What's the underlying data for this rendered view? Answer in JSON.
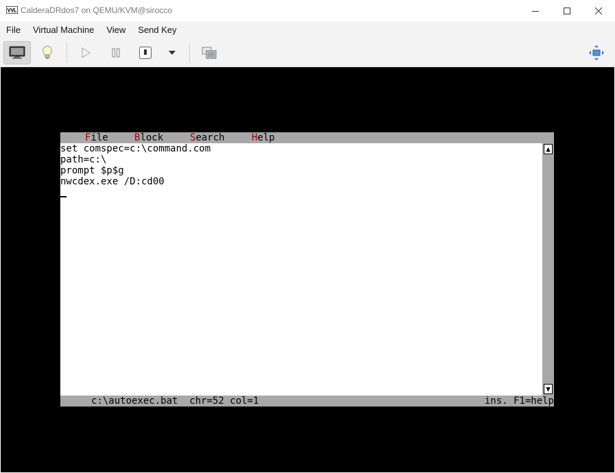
{
  "window": {
    "title": "CalderaDRdos7 on QEMU/KVM@sirocco",
    "icon": "virt-manager-icon",
    "controls": [
      "minimize-icon",
      "maximize-icon",
      "close-icon"
    ]
  },
  "menubar": {
    "items": [
      "File",
      "Virtual Machine",
      "View",
      "Send Key"
    ]
  },
  "toolbar": {
    "buttons": [
      {
        "name": "console-icon",
        "active": true
      },
      {
        "name": "details-bulb-icon",
        "active": false
      },
      {
        "name": "run-icon",
        "active": false
      },
      {
        "name": "pause-icon",
        "active": false
      },
      {
        "name": "power-icon",
        "active": false
      },
      {
        "name": "dropdown-arrow-icon",
        "active": false
      },
      {
        "name": "snapshots-icon",
        "active": false
      },
      {
        "name": "fullscreen-resize-icon",
        "active": false
      }
    ]
  },
  "dos_editor": {
    "menu": [
      {
        "hotkey": "F",
        "rest": "ile"
      },
      {
        "hotkey": "B",
        "rest": "lock"
      },
      {
        "hotkey": "S",
        "rest": "earch"
      },
      {
        "hotkey": "H",
        "rest": "elp"
      }
    ],
    "lines": [
      "set comspec=c:\\command.com",
      "path=c:\\",
      "prompt $p$g",
      "nwcdex.exe /D:cd00"
    ],
    "status_left": "c:\\autoexec.bat  chr=52 col=1",
    "status_right": "ins. F1=help",
    "colors": {
      "menu_bg": "#a8a8a8",
      "hotkey": "#a80000",
      "editor_bg": "#ffffff",
      "screen_bg": "#000000"
    }
  }
}
